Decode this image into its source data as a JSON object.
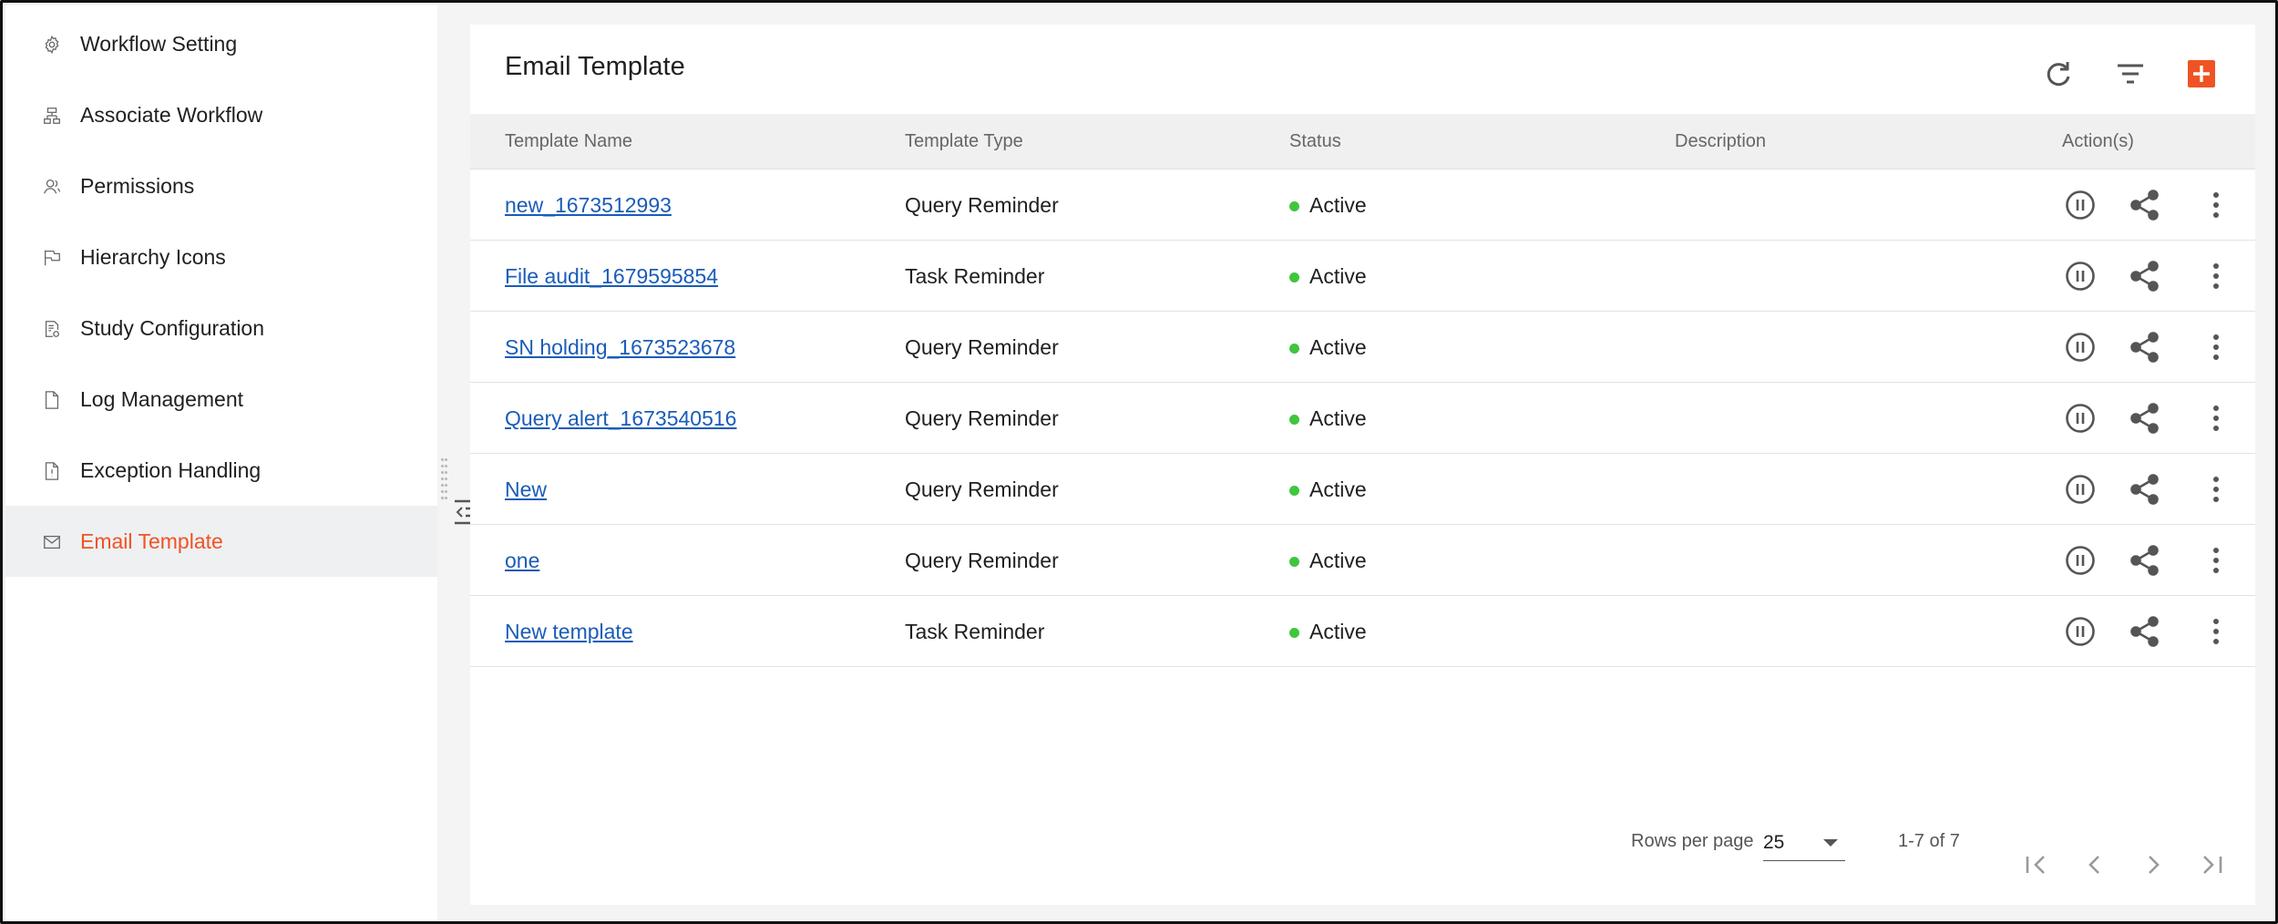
{
  "sidebar": {
    "items": [
      {
        "label": "Workflow Setting",
        "icon": "gear-icon"
      },
      {
        "label": "Associate Workflow",
        "icon": "hierarchy-icon"
      },
      {
        "label": "Permissions",
        "icon": "users-icon"
      },
      {
        "label": "Hierarchy Icons",
        "icon": "flag-icon"
      },
      {
        "label": "Study Configuration",
        "icon": "document-settings-icon"
      },
      {
        "label": "Log Management",
        "icon": "file-icon"
      },
      {
        "label": "Exception Handling",
        "icon": "file-alert-icon"
      },
      {
        "label": "Email Template",
        "icon": "mail-icon",
        "active": true
      }
    ]
  },
  "main": {
    "title": "Email Template",
    "toolbar": {
      "refresh_icon": "refresh-icon",
      "filter_icon": "filter-icon",
      "add_icon": "add-icon"
    },
    "table": {
      "columns": [
        "Template Name",
        "Template Type",
        "Status",
        "Description",
        "Action(s)"
      ],
      "rows": [
        {
          "name": "new_1673512993",
          "type": "Query Reminder",
          "status": "Active",
          "description": ""
        },
        {
          "name": "File audit_1679595854",
          "type": "Task Reminder",
          "status": "Active",
          "description": ""
        },
        {
          "name": "SN holding_1673523678",
          "type": "Query Reminder",
          "status": "Active",
          "description": ""
        },
        {
          "name": "Query alert_1673540516",
          "type": "Query Reminder",
          "status": "Active",
          "description": ""
        },
        {
          "name": "New",
          "type": "Query Reminder",
          "status": "Active",
          "description": ""
        },
        {
          "name": "one",
          "type": "Query Reminder",
          "status": "Active",
          "description": ""
        },
        {
          "name": "New template",
          "type": "Task Reminder",
          "status": "Active",
          "description": ""
        }
      ]
    },
    "pagination": {
      "rows_per_page_label": "Rows per page",
      "rows_per_page_value": "25",
      "range": "1-7 of 7"
    }
  },
  "colors": {
    "accent": "#f05323",
    "link": "#1a5cb8",
    "active_status": "#41c53f"
  }
}
